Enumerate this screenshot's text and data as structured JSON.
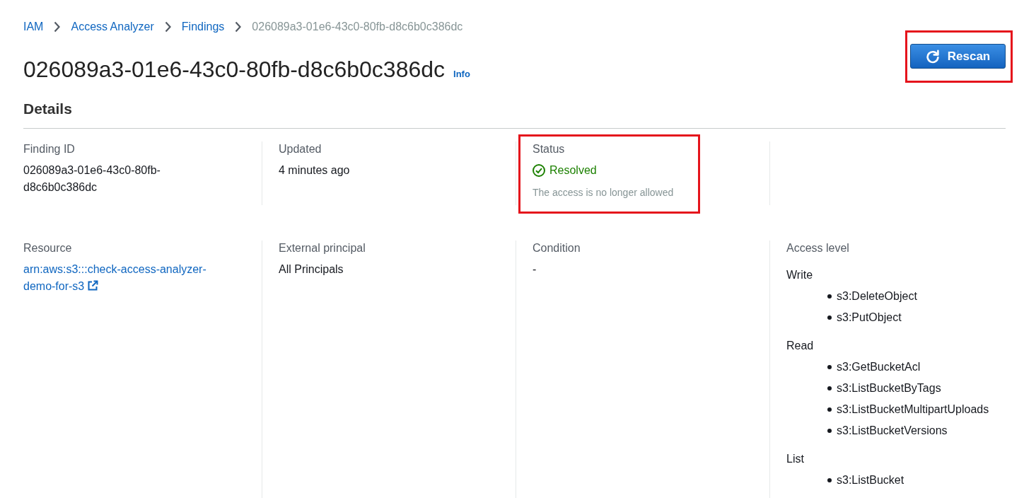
{
  "breadcrumbs": [
    {
      "label": "IAM",
      "kind": "link"
    },
    {
      "label": "Access Analyzer",
      "kind": "link"
    },
    {
      "label": "Findings",
      "kind": "link"
    },
    {
      "label": "026089a3-01e6-43c0-80fb-d8c6b0c386dc",
      "kind": "current"
    }
  ],
  "header": {
    "title": "026089a3-01e6-43c0-80fb-d8c6b0c386dc",
    "info_link": "Info",
    "rescan_button": {
      "label": "Rescan",
      "highlighted": true
    }
  },
  "details": {
    "heading": "Details",
    "rows": [
      [
        {
          "kind": "text",
          "label": "Finding ID",
          "value": "026089a3-01e6-43c0-80fb-d8c6b0c386dc",
          "highlighted": false
        },
        {
          "kind": "text",
          "label": "Updated",
          "value": "4 minutes ago",
          "highlighted": false
        },
        {
          "kind": "status",
          "label": "Status",
          "value": "Resolved",
          "note": "The access is no longer allowed",
          "highlighted": true
        }
      ],
      [
        {
          "kind": "link",
          "label": "Resource",
          "value": "arn:aws:s3:::check-access-analyzer-demo-for-s3",
          "highlighted": false
        },
        {
          "kind": "text",
          "label": "External principal",
          "value": "All Principals",
          "highlighted": false
        },
        {
          "kind": "text",
          "label": "Condition",
          "value": "-",
          "highlighted": false
        },
        {
          "kind": "access",
          "label": "Access level",
          "highlighted": false,
          "groups": [
            {
              "label": "Write",
              "actions": [
                "s3:DeleteObject",
                "s3:PutObject"
              ]
            },
            {
              "label": "Read",
              "actions": [
                "s3:GetBucketAcl",
                "s3:ListBucketByTags",
                "s3:ListBucketMultipartUploads",
                "s3:ListBucketVersions"
              ]
            },
            {
              "label": "List",
              "actions": [
                "s3:ListBucket"
              ]
            }
          ]
        }
      ]
    ]
  }
}
